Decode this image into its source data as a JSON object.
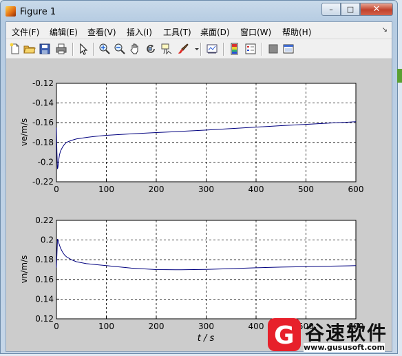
{
  "window": {
    "title": "Figure 1",
    "min_label": "–",
    "max_label": "□",
    "close_label": "✕"
  },
  "menu": [
    "文件(F)",
    "编辑(E)",
    "查看(V)",
    "插入(I)",
    "工具(T)",
    "桌面(D)",
    "窗口(W)",
    "帮助(H)"
  ],
  "menu_overflow": "↘",
  "toolbar": [
    "new-figure-icon",
    "open-file-icon",
    "save-icon",
    "print-icon",
    "select-arrow-icon",
    "zoom-in-icon",
    "zoom-out-icon",
    "pan-hand-icon",
    "rotate-3d-icon",
    "data-cursor-icon",
    "brush-icon",
    "brush-dropdown-icon",
    "link-plot-icon",
    "colorbar-icon",
    "legend-icon",
    "hide-plot-tools-icon",
    "show-plot-tools-icon"
  ],
  "chart_data": [
    {
      "type": "line",
      "ylabel": "ve/m/s",
      "xlim": [
        0,
        600
      ],
      "ylim": [
        -0.22,
        -0.12
      ],
      "xticks": [
        "0",
        "100",
        "200",
        "300",
        "400",
        "500",
        "600"
      ],
      "yticks": [
        "-0.12",
        "-0.14",
        "-0.16",
        "-0.18",
        "-0.2",
        "-0.22"
      ],
      "grid": true,
      "series": [
        {
          "color": "#00007f",
          "x": [
            0,
            1,
            2,
            3,
            4,
            6,
            8,
            12,
            16,
            20,
            30,
            40,
            60,
            80,
            100,
            150,
            200,
            250,
            300,
            350,
            400,
            450,
            500,
            550,
            600
          ],
          "y": [
            -0.165,
            -0.19,
            -0.207,
            -0.205,
            -0.2,
            -0.193,
            -0.189,
            -0.185,
            -0.182,
            -0.18,
            -0.178,
            -0.1765,
            -0.175,
            -0.1738,
            -0.1728,
            -0.1713,
            -0.17,
            -0.1688,
            -0.1675,
            -0.166,
            -0.1645,
            -0.163,
            -0.1617,
            -0.1603,
            -0.159
          ]
        }
      ]
    },
    {
      "type": "line",
      "xlabel": "t / s",
      "ylabel": "vn/m/s",
      "xlim": [
        0,
        600
      ],
      "ylim": [
        0.12,
        0.22
      ],
      "xticks": [
        "0",
        "100",
        "200",
        "300",
        "400",
        "500",
        "600"
      ],
      "yticks": [
        "0.22",
        "0.2",
        "0.18",
        "0.16",
        "0.14",
        "0.12"
      ],
      "grid": true,
      "series": [
        {
          "color": "#00007f",
          "x": [
            0,
            2,
            4,
            8,
            12,
            16,
            20,
            30,
            40,
            60,
            80,
            100,
            150,
            200,
            250,
            300,
            350,
            400,
            450,
            500,
            550,
            600
          ],
          "y": [
            0.172,
            0.201,
            0.198,
            0.192,
            0.188,
            0.185,
            0.183,
            0.18,
            0.178,
            0.176,
            0.175,
            0.174,
            0.1715,
            0.17,
            0.1698,
            0.1702,
            0.171,
            0.1718,
            0.1725,
            0.173,
            0.1735,
            0.174
          ]
        }
      ]
    }
  ],
  "watermark": {
    "logo_letter": "G",
    "name": "谷速软件",
    "url": "www.gususoft.com"
  }
}
